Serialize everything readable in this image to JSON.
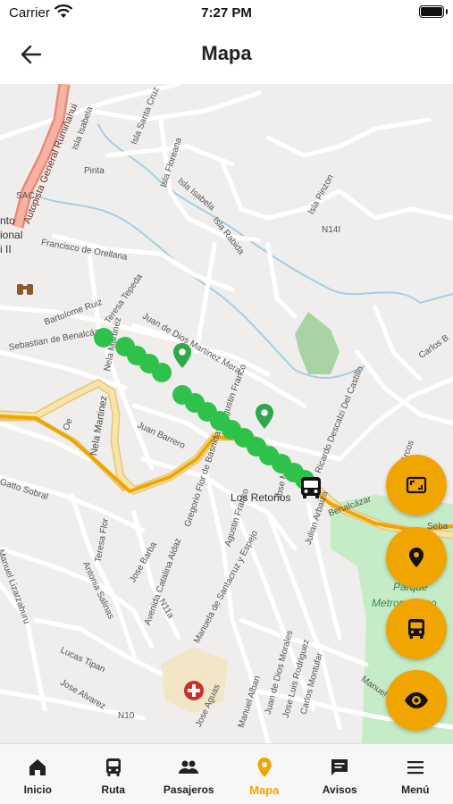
{
  "status_bar": {
    "carrier": "Carrier",
    "time": "7:27 PM"
  },
  "header": {
    "title": "Mapa",
    "back_icon": "arrow-left-icon"
  },
  "map": {
    "street_labels": {
      "autopista": "Autopista General Rumiñahui",
      "isla_isabela_1": "Isla Isabela",
      "isla_santa_cruz": "Isla Santa Cruz",
      "isla_floreana": "Isla Floreana",
      "isla_isabela_2": "Isla Isabela",
      "isla_rabida": "Isla Rabida",
      "isla_pinzon": "Isla Pinzon",
      "n14i": "N14I",
      "pinta": "Pinta",
      "francisco_orellana": "Francisco de Orellana",
      "bartolome_ruiz": "Bartolome Ruiz",
      "sebastian_benalcazar": "Sebastian de Benalcázar",
      "teresa_tepeda": "Teresa Tepeda",
      "juan_dios_martinez_mera": "Juan de Dios Martinez Mera",
      "carlos_b": "Carlos B",
      "nela_martinez_1": "Nela Martinez",
      "juan_barrero": "Juan Barrero",
      "nela_martinez_2": "Nela Martinez",
      "gregorio_flor": "Gregorio Flor de Basnidas",
      "los_retonos": "Los Retoños",
      "ricardo_descalzi": "Ricardo Descalzi Del Castillo",
      "arcos": "Arcos",
      "agustin_franco_1": "Agustin Franco",
      "agustin_franco_2": "Agustin Franco",
      "jose_mejia": "Jose Mejia",
      "julian_arbaiza": "Julian Arbaiza",
      "benalcazar_short": "Benalcázar",
      "seba": "Seba",
      "gatto_sobral": "Gatto Sobral",
      "manuel_lizarzaburu": "Manuel Lizarzaburu",
      "teresa_flor": "Teresa Flor",
      "antonia_salinas": "Antonia Salinas",
      "jose_barba": "Jose Barba",
      "n11a": "N11a",
      "avenida_catalina": "Avenida Catalina Aldaz",
      "manuela_santacruz": "Manuela de Santacruz y Espejo",
      "parque": "Parque",
      "metropolitano": "Metropolitano",
      "lucas_tipan": "Lucas Tipan",
      "jose_alvarez": "Jose Alvarez",
      "n10": "N10",
      "jose_aguas": "Jose Aguas",
      "manuel_alban": "Manuel Alban",
      "juan_dios_morales": "Juan de Dios Morales",
      "jose_luis_rodriguez": "Jose Luis Rodriguez",
      "carlos_montufar": "Carlos Montufar",
      "manuel_short": "Manuel",
      "sac": "SAC",
      "nto": "nto",
      "ional": "ional",
      "i_ii": "i II",
      "oe": "Oe"
    },
    "markers": [
      "bus-stop-pin",
      "bus-stop-pin",
      "bus-marker",
      "hospital-marker",
      "binoculars-marker"
    ]
  },
  "fabs": [
    {
      "name": "fullscreen-button",
      "icon": "fullscreen-icon"
    },
    {
      "name": "location-button",
      "icon": "location-pin-icon"
    },
    {
      "name": "bus-button",
      "icon": "bus-icon"
    },
    {
      "name": "view-button",
      "icon": "eye-icon"
    }
  ],
  "tabs": [
    {
      "label": "Inicio",
      "icon": "home-icon"
    },
    {
      "label": "Ruta",
      "icon": "bus-icon"
    },
    {
      "label": "Pasajeros",
      "icon": "people-icon"
    },
    {
      "label": "Mapa",
      "icon": "location-pin-icon",
      "active": true
    },
    {
      "label": "Avisos",
      "icon": "message-icon"
    },
    {
      "label": "Menú",
      "icon": "menu-icon"
    }
  ],
  "colors": {
    "accent": "#f0a500",
    "route": "#2ec24a",
    "stop_pin": "#2ea84a"
  }
}
